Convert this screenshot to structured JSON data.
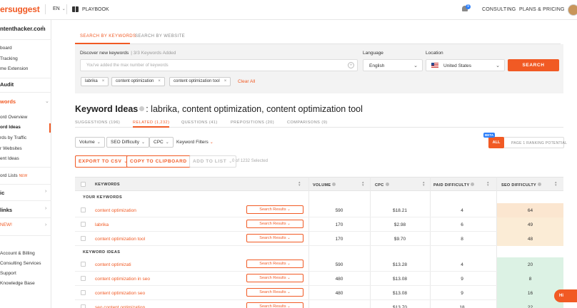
{
  "nav": {
    "logo": "ersuggest",
    "lang": "EN",
    "playbook": "PLAYBOOK",
    "bell_count": "9",
    "consulting": "CONSULTING",
    "plans": "PLANS & PRICING"
  },
  "sidebar": {
    "domain": "ntenthacker.com",
    "items_top": [
      "board",
      "Tracking",
      "me Extension"
    ],
    "audit": "Audit",
    "keywords": "words",
    "kw_items": [
      "ord Overview",
      "ord Ideas",
      "rds by Traffic",
      "r Websites",
      "ent Ideas"
    ],
    "kw_lists": "ord Lists",
    "new_tag": "NEW",
    "sec_c": "ic",
    "sec_links": "links",
    "sec_new": "NEW!",
    "bottom": [
      "Account & Billing",
      "Consulting Services",
      "Support",
      "Knowledge Base"
    ]
  },
  "search": {
    "tab_keywords": "SEARCH BY KEYWORDS",
    "tab_website": "SEARCH BY WEBSITE",
    "discover_label": "Discover new keywords",
    "added_count": "| 3/3 Keywords Added",
    "input_placeholder": "You've added the max number of keywords",
    "language_label": "Language",
    "language_value": "English",
    "location_label": "Location",
    "location_value": "United States",
    "search_button": "SEARCH",
    "chips": [
      "labrika",
      "content optimization",
      "content optimization tool"
    ],
    "clear_all": "Clear All"
  },
  "ideas": {
    "title_bold": "Keyword Ideas",
    "title_rest": ": labrika, content optimization, content optimization tool",
    "subtabs": [
      "SUGGESTIONS (196)",
      "RELATED (1,232)",
      "QUESTIONS (41)",
      "PREPOSITIONS (20)",
      "COMPARISONS (9)"
    ],
    "filters": [
      "Volume",
      "SEO Difficulty",
      "CPC"
    ],
    "keyword_filters": "Keyword Filters",
    "beta": "BETA",
    "toggle_all": "ALL",
    "toggle_page1": "PAGE 1 RANKING POTENTIAL",
    "export_csv": "EXPORT TO CSV",
    "copy_clipboard": "COPY TO CLIPBOARD",
    "add_to_list": "ADD TO LIST",
    "selected": "0 of 1232 Selected"
  },
  "table": {
    "headers": [
      "KEYWORDS",
      "VOLUME",
      "CPC",
      "PAID DIFFICULTY",
      "SEO DIFFICULTY"
    ],
    "group_your": "YOUR KEYWORDS",
    "group_ideas": "KEYWORD IDEAS",
    "search_results_label": "Search Results",
    "your_rows": [
      {
        "keyword": "content optimization",
        "volume": "590",
        "cpc": "$18.21",
        "pd": "4",
        "sd": "64",
        "sd_color": "#fbe6d0"
      },
      {
        "keyword": "labrika",
        "volume": "170",
        "cpc": "$2.98",
        "pd": "6",
        "sd": "49",
        "sd_color": "#fbecd6"
      },
      {
        "keyword": "content optimization tool",
        "volume": "170",
        "cpc": "$9.70",
        "pd": "8",
        "sd": "48",
        "sd_color": "#fbecd6"
      }
    ],
    "idea_rows": [
      {
        "keyword": "content optimizati",
        "volume": "590",
        "cpc": "$13.28",
        "pd": "4",
        "sd": "20",
        "sd_color": "#dcf2e4"
      },
      {
        "keyword": "content optimization in seo",
        "volume": "480",
        "cpc": "$13.08",
        "pd": "9",
        "sd": "8",
        "sd_color": "#dcf2e4"
      },
      {
        "keyword": "content optimization seo",
        "volume": "480",
        "cpc": "$13.08",
        "pd": "9",
        "sd": "16",
        "sd_color": "#dcf2e4"
      },
      {
        "keyword": "seo content optimization",
        "volume": "",
        "cpc": "$13.70",
        "pd": "18",
        "sd": "22",
        "sd_color": "#dcf2e4"
      }
    ]
  },
  "help": "Hi"
}
